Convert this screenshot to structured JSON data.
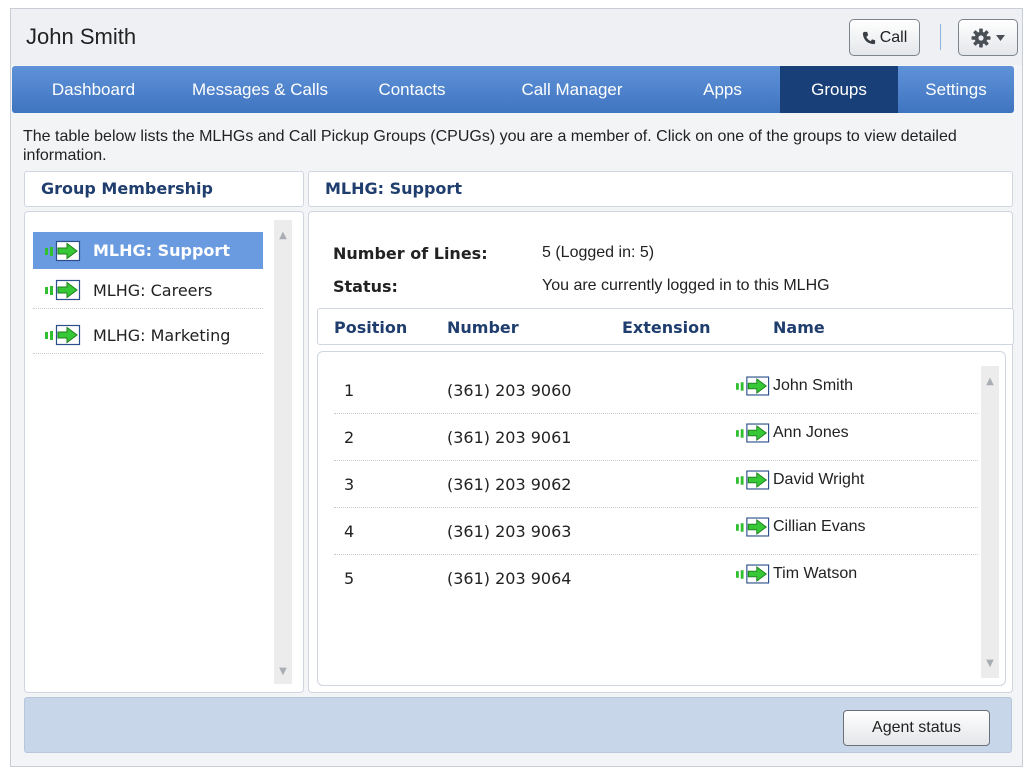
{
  "window": {
    "title": "John Smith"
  },
  "toolbar": {
    "call_label": "Call"
  },
  "nav": {
    "tabs": [
      {
        "label": "Dashboard"
      },
      {
        "label": "Messages & Calls"
      },
      {
        "label": "Contacts"
      },
      {
        "label": "Call Manager"
      },
      {
        "label": "Apps"
      },
      {
        "label": "Groups",
        "active": true
      },
      {
        "label": "Settings"
      }
    ]
  },
  "intro_text": "The table below lists the MLHGs and Call Pickup Groups (CPUGs) you are a member of. Click on one of the groups to view detailed information.",
  "membership": {
    "header": "Group Membership",
    "items": [
      {
        "label": "MLHG: Support",
        "selected": true
      },
      {
        "label": "MLHG: Careers"
      },
      {
        "label": "MLHG: Marketing"
      }
    ]
  },
  "detail": {
    "header": "MLHG: Support",
    "lines_label": "Number of Lines:",
    "lines_value": "5  (Logged in: 5)",
    "status_label": "Status:",
    "status_value": "You are currently logged in to this MLHG",
    "columns": {
      "position": "Position",
      "number": "Number",
      "extension": "Extension",
      "name": "Name"
    },
    "rows": [
      {
        "position": "1",
        "number": "(361) 203 9060",
        "extension": "",
        "name": "John Smith"
      },
      {
        "position": "2",
        "number": "(361) 203 9061",
        "extension": "",
        "name": "Ann Jones"
      },
      {
        "position": "3",
        "number": "(361) 203 9062",
        "extension": "",
        "name": "David Wright"
      },
      {
        "position": "4",
        "number": "(361) 203 9063",
        "extension": "",
        "name": "Cillian Evans"
      },
      {
        "position": "5",
        "number": "(361) 203 9064",
        "extension": "",
        "name": "Tim Watson"
      }
    ]
  },
  "footer": {
    "agent_status_label": "Agent status"
  },
  "icons": {
    "logged_in": "arrow-right-icon",
    "phone": "phone-icon",
    "settings": "gear-icon",
    "dropdown": "caret-down-icon"
  },
  "colors": {
    "nav_blue": "#4a80cc",
    "nav_active": "#193f78",
    "selected_item": "#6a9ae0",
    "header_text": "#1f3e6e",
    "logged_in_green": "#27c227"
  }
}
